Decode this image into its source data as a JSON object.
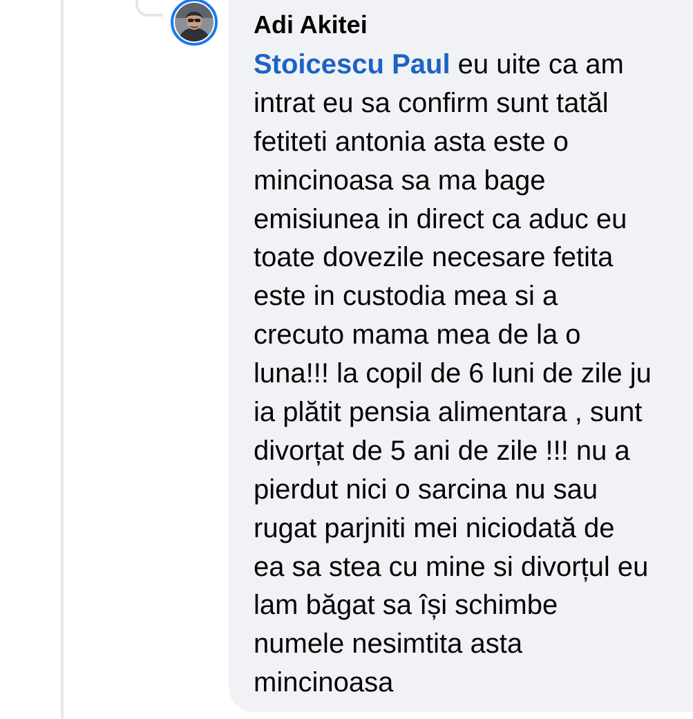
{
  "comment": {
    "author": "Adi Akitei",
    "mention": "Stoicescu Paul",
    "lines": [
      " eu uite ca am",
      "intrat eu sa confirm sunt tatăl",
      "fetiteti antonia asta este o",
      "mincinoasa sa ma bage",
      "emisiunea in direct ca aduc eu",
      "toate dovezile necesare fetita",
      "este in custodia mea si a",
      "crecuto mama mea de la o",
      "luna!!! la copil de 6 luni de zile ju",
      "ia plătit pensia alimentara , sunt",
      "divorțat de 5 ani de zile !!! nu a",
      "pierdut nici o sarcina nu sau",
      "rugat parjniti mei niciodată de",
      "ea sa stea cu mine si divorțul eu",
      "lam băgat sa își schimbe",
      "numele nesimtita asta",
      "mincinoasa"
    ]
  },
  "colors": {
    "mention": "#1b63c4",
    "avatar_ring": "#1877f2",
    "bubble_bg": "#f0f2f5",
    "thread_line": "#e4e6eb",
    "text": "#050505"
  },
  "icons": {
    "avatar": "user-avatar"
  }
}
